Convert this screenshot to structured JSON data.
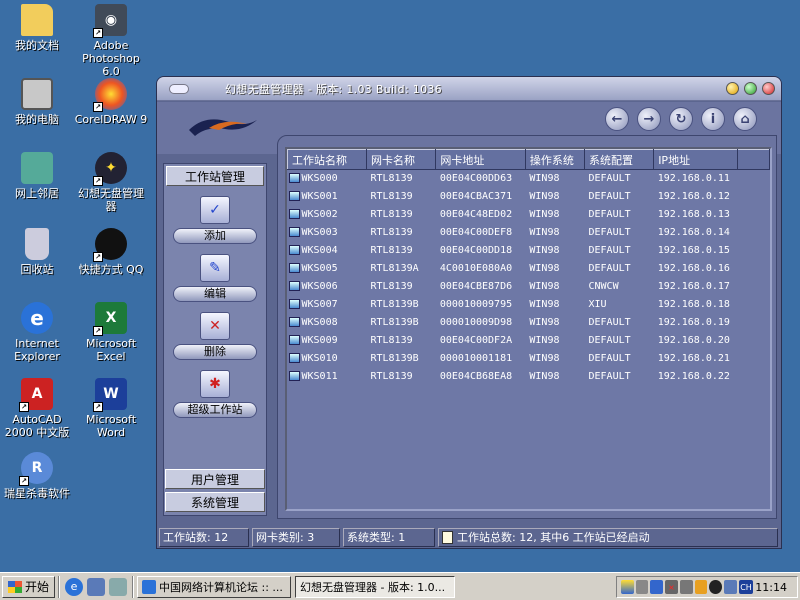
{
  "desktop": {
    "icons": [
      {
        "label": "我的文档",
        "glyph": "folder-icon"
      },
      {
        "label": "Adobe Photoshop 6.0",
        "glyph": "photoshop-icon"
      },
      {
        "label": "我的电脑",
        "glyph": "computer-icon"
      },
      {
        "label": "CorelDRAW 9",
        "glyph": "coreldraw-icon"
      },
      {
        "label": "网上邻居",
        "glyph": "network-icon"
      },
      {
        "label": "幻想无盘管理器",
        "glyph": "app-shortcut-icon"
      },
      {
        "label": "回收站",
        "glyph": "recycle-bin-icon"
      },
      {
        "label": "快捷方式 QQ",
        "glyph": "qq-icon"
      },
      {
        "label": "Internet Explorer",
        "glyph": "ie-icon"
      },
      {
        "label": "Microsoft Excel",
        "glyph": "excel-icon"
      },
      {
        "label": "AutoCAD 2000 中文版",
        "glyph": "autocad-icon"
      },
      {
        "label": "Microsoft Word",
        "glyph": "word-icon"
      },
      {
        "label": "瑞星杀毒软件",
        "glyph": "antivirus-icon"
      }
    ]
  },
  "window": {
    "title": "幻想无盘管理器 - 版本: 1.03 Build: 1036"
  },
  "nav": {
    "back": "←",
    "forward": "→",
    "refresh": "↻",
    "info": "i",
    "home": "⌂"
  },
  "left_panel": {
    "workstation_section": "工作站管理",
    "tools": [
      {
        "label": "添加",
        "icon": "add-workstation-icon",
        "glyph": "✓"
      },
      {
        "label": "编辑",
        "icon": "edit-workstation-icon",
        "glyph": "✎"
      },
      {
        "label": "删除",
        "icon": "delete-workstation-icon",
        "glyph": "✕"
      },
      {
        "label": "超级工作站",
        "icon": "super-workstation-icon",
        "glyph": "✱"
      }
    ],
    "user_section": "用户管理",
    "system_section": "系统管理"
  },
  "table": {
    "columns": [
      "工作站名称",
      "网卡名称",
      "网卡地址",
      "操作系统",
      "系统配置",
      "IP地址"
    ],
    "rows": [
      [
        "WKS000",
        "RTL8139",
        "00E04C00DD63",
        "WIN98",
        "DEFAULT",
        "192.168.0.11"
      ],
      [
        "WKS001",
        "RTL8139",
        "00E04CBAC371",
        "WIN98",
        "DEFAULT",
        "192.168.0.12"
      ],
      [
        "WKS002",
        "RTL8139",
        "00E04C48ED02",
        "WIN98",
        "DEFAULT",
        "192.168.0.13"
      ],
      [
        "WKS003",
        "RTL8139",
        "00E04C00DEF8",
        "WIN98",
        "DEFAULT",
        "192.168.0.14"
      ],
      [
        "WKS004",
        "RTL8139",
        "00E04C00DD18",
        "WIN98",
        "DEFAULT",
        "192.168.0.15"
      ],
      [
        "WKS005",
        "RTL8139A",
        "4C0010E080A0",
        "WIN98",
        "DEFAULT",
        "192.168.0.16"
      ],
      [
        "WKS006",
        "RTL8139",
        "00E04CBE87D6",
        "WIN98",
        "CNWCW",
        "192.168.0.17"
      ],
      [
        "WKS007",
        "RTL8139B",
        "000010009795",
        "WIN98",
        "XIU",
        "192.168.0.18"
      ],
      [
        "WKS008",
        "RTL8139B",
        "000010009D98",
        "WIN98",
        "DEFAULT",
        "192.168.0.19"
      ],
      [
        "WKS009",
        "RTL8139",
        "00E04C00DF2A",
        "WIN98",
        "DEFAULT",
        "192.168.0.20"
      ],
      [
        "WKS010",
        "RTL8139B",
        "000010001181",
        "WIN98",
        "DEFAULT",
        "192.168.0.21"
      ],
      [
        "WKS011",
        "RTL8139",
        "00E04CB68EA8",
        "WIN98",
        "DEFAULT",
        "192.168.0.22"
      ]
    ]
  },
  "status": {
    "workstation_count": "工作站数: 12",
    "nic_types": "网卡类别: 3",
    "system_types": "系统类型: 1",
    "summary": "工作站总数: 12, 其中6 工作站已经启动"
  },
  "taskbar": {
    "start_label": "开始",
    "tasks": [
      {
        "label": "中国网络计算机论坛 :: ..."
      },
      {
        "label": "幻想无盘管理器 - 版本: 1.0..."
      }
    ],
    "tray_ime": "CH",
    "clock": "11:14"
  },
  "colors": {
    "desktop": "#3a6ea5",
    "window_body": "#5c6690",
    "list_bg": "#6e78a6",
    "taskbar": "#d4d0c8"
  }
}
